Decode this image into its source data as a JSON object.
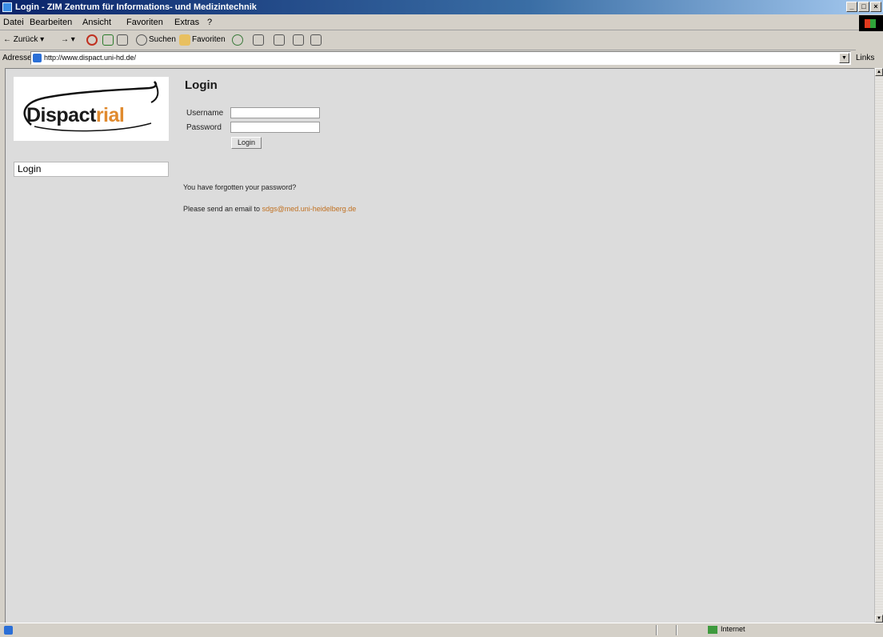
{
  "window": {
    "title": "Login - ZIM Zentrum für Informations- und Medizintechnik",
    "buttons": {
      "minimize": "_",
      "maximize": "□",
      "close": "×"
    }
  },
  "menubar": {
    "items": [
      "Datei",
      "Bearbeiten",
      "Ansicht",
      "Favoriten",
      "Extras",
      "?"
    ]
  },
  "toolbar": {
    "back_label": "Zurück",
    "search_label": "Suchen",
    "favorites_label": "Favoriten"
  },
  "addressbar": {
    "label": "Adresse",
    "url": "http://www.dispact.uni-hd.de/",
    "links_label": "Links"
  },
  "sidebar": {
    "logo": {
      "main": "Dispact",
      "accent": "rial"
    },
    "nav": [
      {
        "label": "Login"
      }
    ]
  },
  "main": {
    "heading": "Login",
    "username_label": "Username",
    "password_label": "Password",
    "username_value": "",
    "password_value": "",
    "submit_label": "Login",
    "forgot_text": "You have forgotten your password?",
    "contact_prefix": "Please send an email to",
    "contact_email": "sdgs@med.uni-heidelberg.de"
  },
  "statusbar": {
    "zone_label": "Internet"
  },
  "colors": {
    "brand_accent": "#e08a2e",
    "link": "#c07020",
    "page_background": "#dcdcdc",
    "title_gradient_start": "#0a246a"
  },
  "icons": [
    "browser-icon",
    "back-icon",
    "forward-icon",
    "stop-icon",
    "refresh-icon",
    "home-icon",
    "search-icon",
    "favorites-icon",
    "history-icon",
    "mail-icon",
    "print-icon",
    "windows-logo-icon",
    "ie-page-icon",
    "internet-zone-icon"
  ]
}
